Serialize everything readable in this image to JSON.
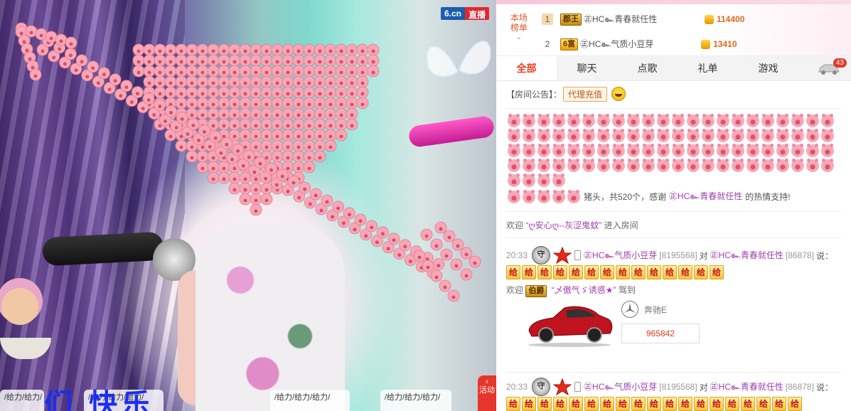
{
  "video": {
    "logo_site": "6.cn",
    "logo_live": "直播",
    "cheer_text_1": "/给力/给力/",
    "cheer_text_2": "/给力/给力/给力/",
    "cheer_text_3": "/给力/给力/给力/",
    "cheer_text_4": "/给力/给力/给力/",
    "big_text": "们 快乐",
    "activity_tab": "活动"
  },
  "rank": {
    "label_line1": "本场",
    "label_line2": "榜单",
    "rows": [
      {
        "num": "1",
        "badge": "郡王",
        "name": "㊣HC๛青春就任性",
        "value": "114400"
      },
      {
        "num": "2",
        "badge": "6富",
        "name": "㊣HC๛气质小豆芽",
        "value": "13410"
      }
    ]
  },
  "tabs": [
    "全部",
    "聊天",
    "点歌",
    "礼单",
    "游戏"
  ],
  "car_tab_count": "43",
  "chat": {
    "notice_label": "【房间公告】：",
    "notice_button": "代理充值",
    "pig_gift_text": "猪头，共520个，感谢",
    "pig_gift_user": "㊣HC๛青春就任性",
    "pig_gift_suffix": "的热情支持!",
    "welcome1_prefix": "欢迎",
    "welcome1_user": "“ღ安心ღ--灰涩鬼蚊”",
    "welcome1_suffix": "进入房间",
    "msg1_time": "20:33",
    "msg1_from": "㊣HC๛气质小豆芽",
    "msg1_from_id": "[8195568]",
    "msg1_to_word": "对",
    "msg1_to": "㊣HC๛青春就任性",
    "msg1_to_id": "[86878]",
    "msg1_say": "说：",
    "gift_char": "给",
    "welcome2_prefix": "欢迎",
    "welcome2_badge": "伯爵",
    "welcome2_user": "“乄傲气ゞ诱惑★”",
    "welcome2_suffix": "驾到",
    "car_name": "奔驰E",
    "car_number": "965842",
    "msg2_time": "20:33",
    "msg2_from": "㊣HC๛气质小豆芽",
    "msg2_from_id": "[8195568]",
    "msg2_to_word": "对",
    "msg2_to": "㊣HC๛青春就任性",
    "msg2_to_id": "[86878]",
    "msg2_say": "说：",
    "guard_char": "守"
  },
  "colors": {
    "accent": "#e8401c",
    "username": "#a040b0",
    "coin_value": "#e06a1a"
  }
}
